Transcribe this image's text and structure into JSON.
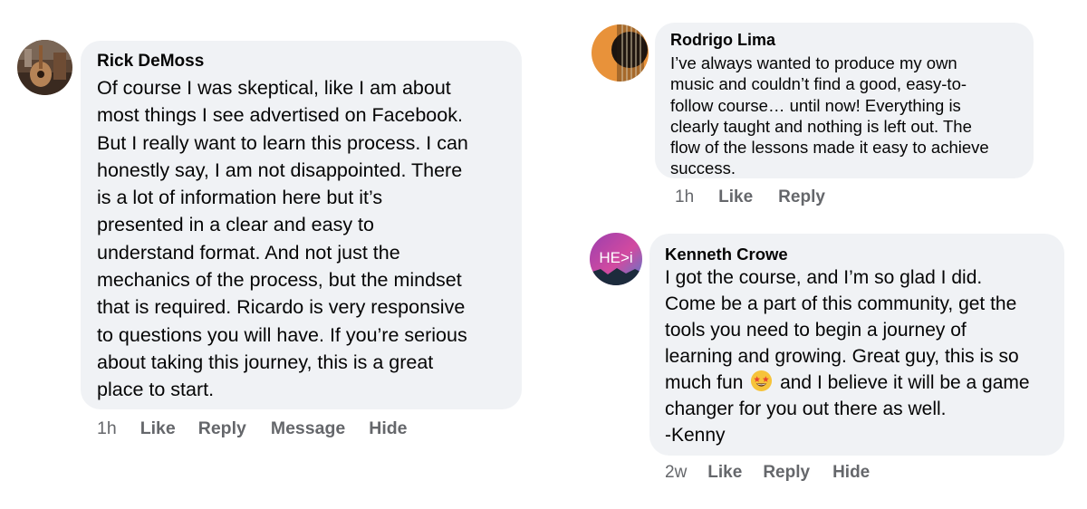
{
  "comments": [
    {
      "author": "Rick DeMoss",
      "avatar_icon": "guitar-photo-avatar",
      "lines": [
        "Of course I was skeptical, like I am about",
        "most things I see advertised on Facebook.",
        "But I really want to learn this process.  I can",
        "honestly say, I am not disappointed.  There",
        "is a lot of information here but it’s",
        "presented in a clear and easy to",
        "understand format.  And not just the",
        "mechanics of the process, but the mindset",
        "that is required.  Ricardo is very responsive",
        "to questions you will have.  If you’re serious",
        "about taking this journey, this is a great",
        "place to start."
      ],
      "time": "1h",
      "actions": [
        "Like",
        "Reply",
        "Message",
        "Hide"
      ]
    },
    {
      "author": "Rodrigo Lima",
      "avatar_icon": "guitar-avatar",
      "lines": [
        "I’ve always wanted to produce my own",
        "music and couldn’t find a good, easy-to-",
        "follow course… until now! Everything is",
        "clearly taught and nothing is left out. The",
        "flow of the lessons made it easy to achieve",
        "success."
      ],
      "time": "1h",
      "actions": [
        "Like",
        "Reply"
      ]
    },
    {
      "author": "Kenneth Crowe",
      "avatar_icon": "he-logo-avatar",
      "avatar_text": "HE>i",
      "lines_before_emoji": [
        "I got the course, and I’m so glad I did.",
        "Come be a part of this community, get the",
        "tools you need to begin a journey of",
        "learning and growing. Great guy, this is so"
      ],
      "emoji_line_pre": "much fun",
      "emoji_icon": "star-struck-emoji-icon",
      "emoji_line_post": "and I believe it will be a game",
      "lines_after_emoji": [
        "changer for you out there as well.",
        "-Kenny"
      ],
      "time": "2w",
      "actions": [
        "Like",
        "Reply",
        "Hide"
      ]
    }
  ],
  "colors": {
    "bubble": "#f0f2f5",
    "text": "#050505",
    "meta": "#65676b"
  }
}
